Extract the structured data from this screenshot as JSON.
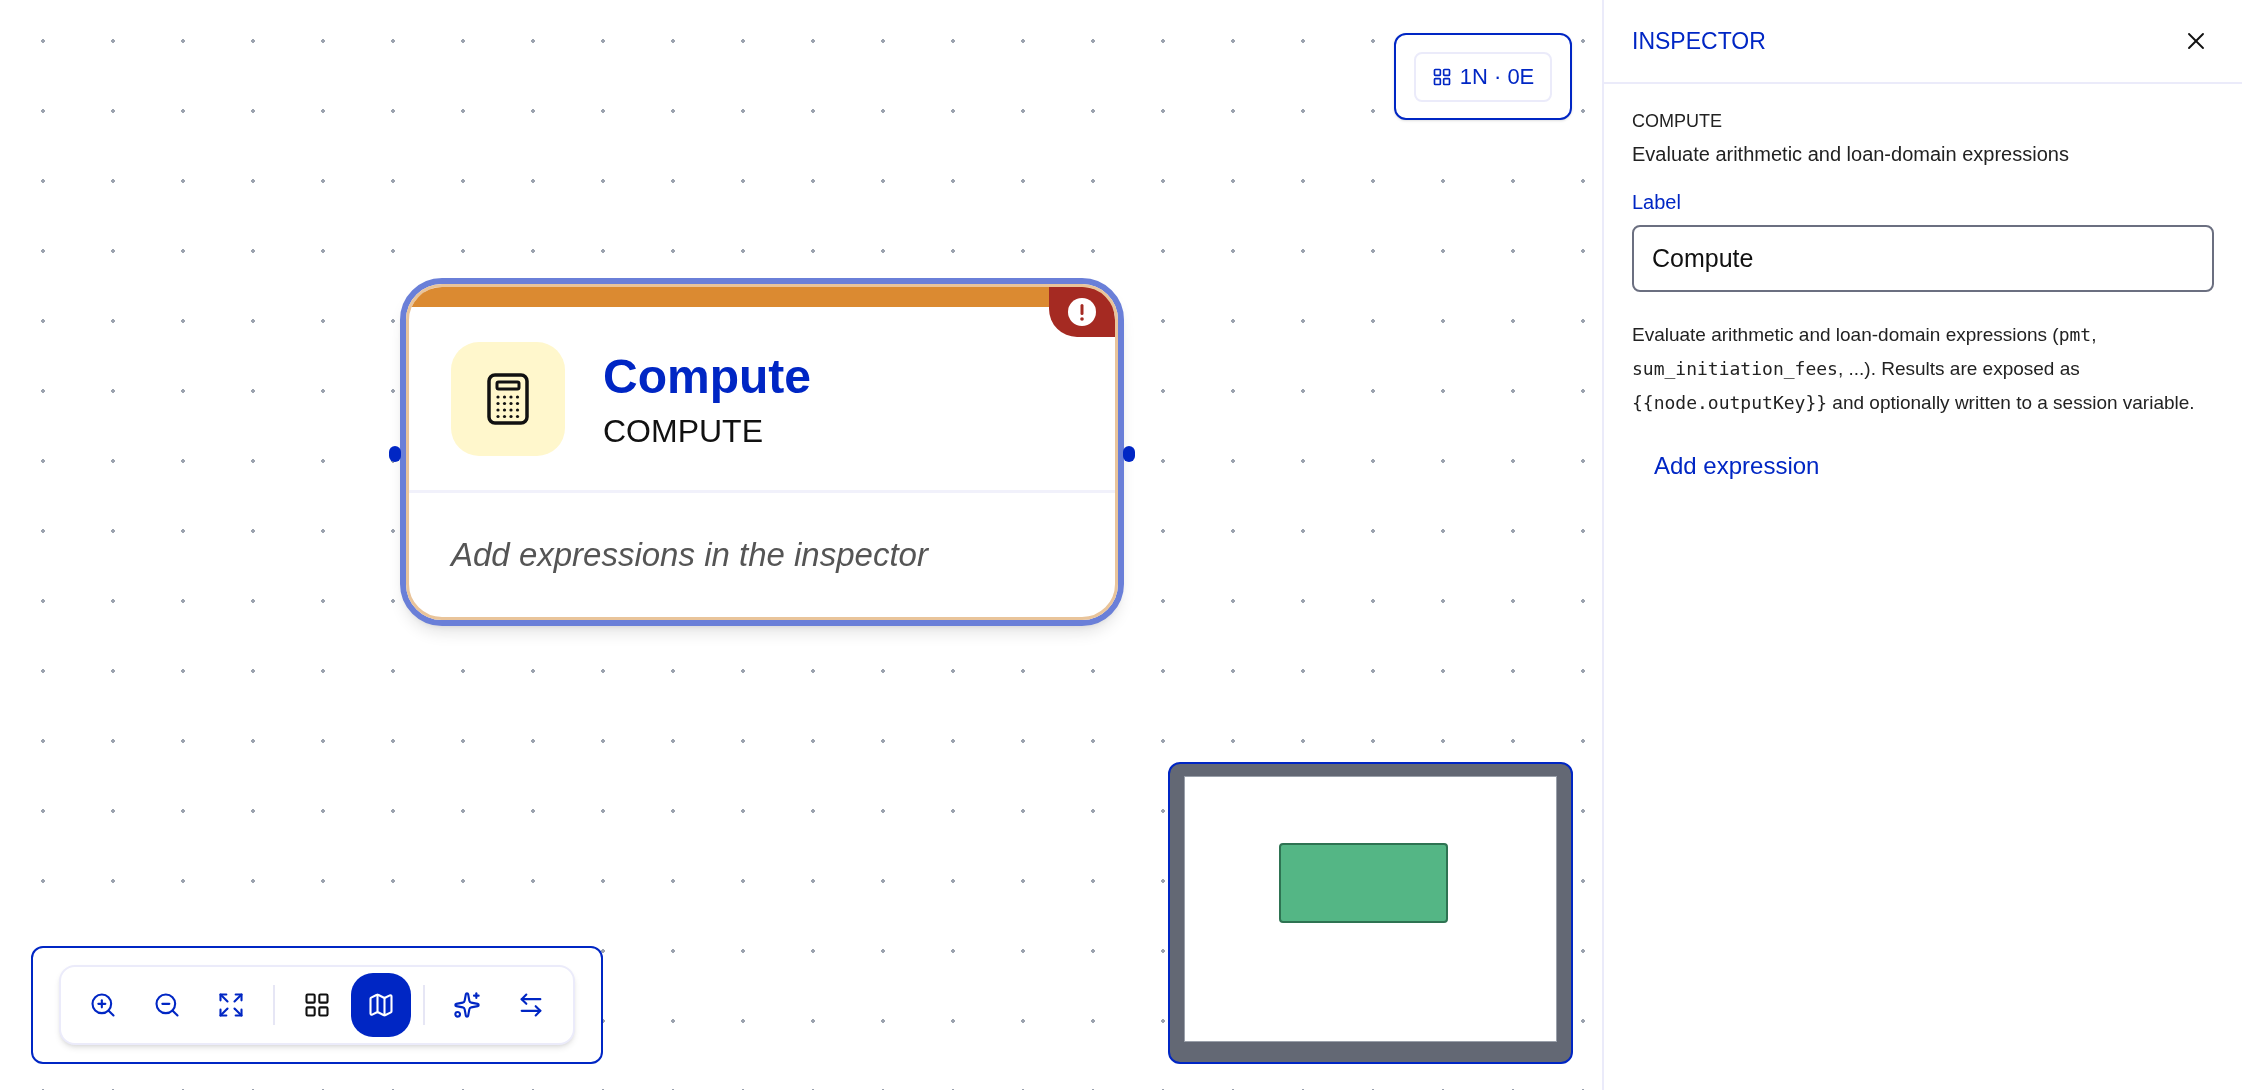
{
  "canvas": {
    "stats": "1N · 0E",
    "node": {
      "title": "Compute",
      "type": "COMPUTE",
      "hint": "Add expressions in the inspector",
      "selected": true,
      "has_error": true
    },
    "toolbar": {
      "groups": [
        [
          {
            "kind": "zoom-in",
            "selected": false
          },
          {
            "kind": "zoom-out",
            "selected": false
          },
          {
            "kind": "fit",
            "selected": false
          }
        ],
        [
          {
            "kind": "grid",
            "selected": false
          },
          {
            "kind": "minimap",
            "selected": true
          }
        ],
        [
          {
            "kind": "sparkle",
            "selected": false
          },
          {
            "kind": "swap",
            "selected": false
          }
        ]
      ]
    }
  },
  "inspector": {
    "title": "INSPECTOR",
    "node_type": "COMPUTE",
    "node_summary": "Evaluate arithmetic and loan-domain expressions",
    "field": {
      "label": "Label",
      "value": "Compute"
    },
    "help": [
      {
        "text": "Evaluate arithmetic and loan-domain expressions (",
        "code": false
      },
      {
        "text": "pmt",
        "code": true
      },
      {
        "text": ", ",
        "code": false
      },
      {
        "text": "sum_initiation_fees",
        "code": true
      },
      {
        "text": ", ...). Results are exposed as ",
        "code": false
      },
      {
        "text": "{{node.outputKey}}",
        "code": true
      },
      {
        "text": " and optionally written to a session variable.",
        "code": false
      }
    ],
    "action": "Add expression"
  }
}
